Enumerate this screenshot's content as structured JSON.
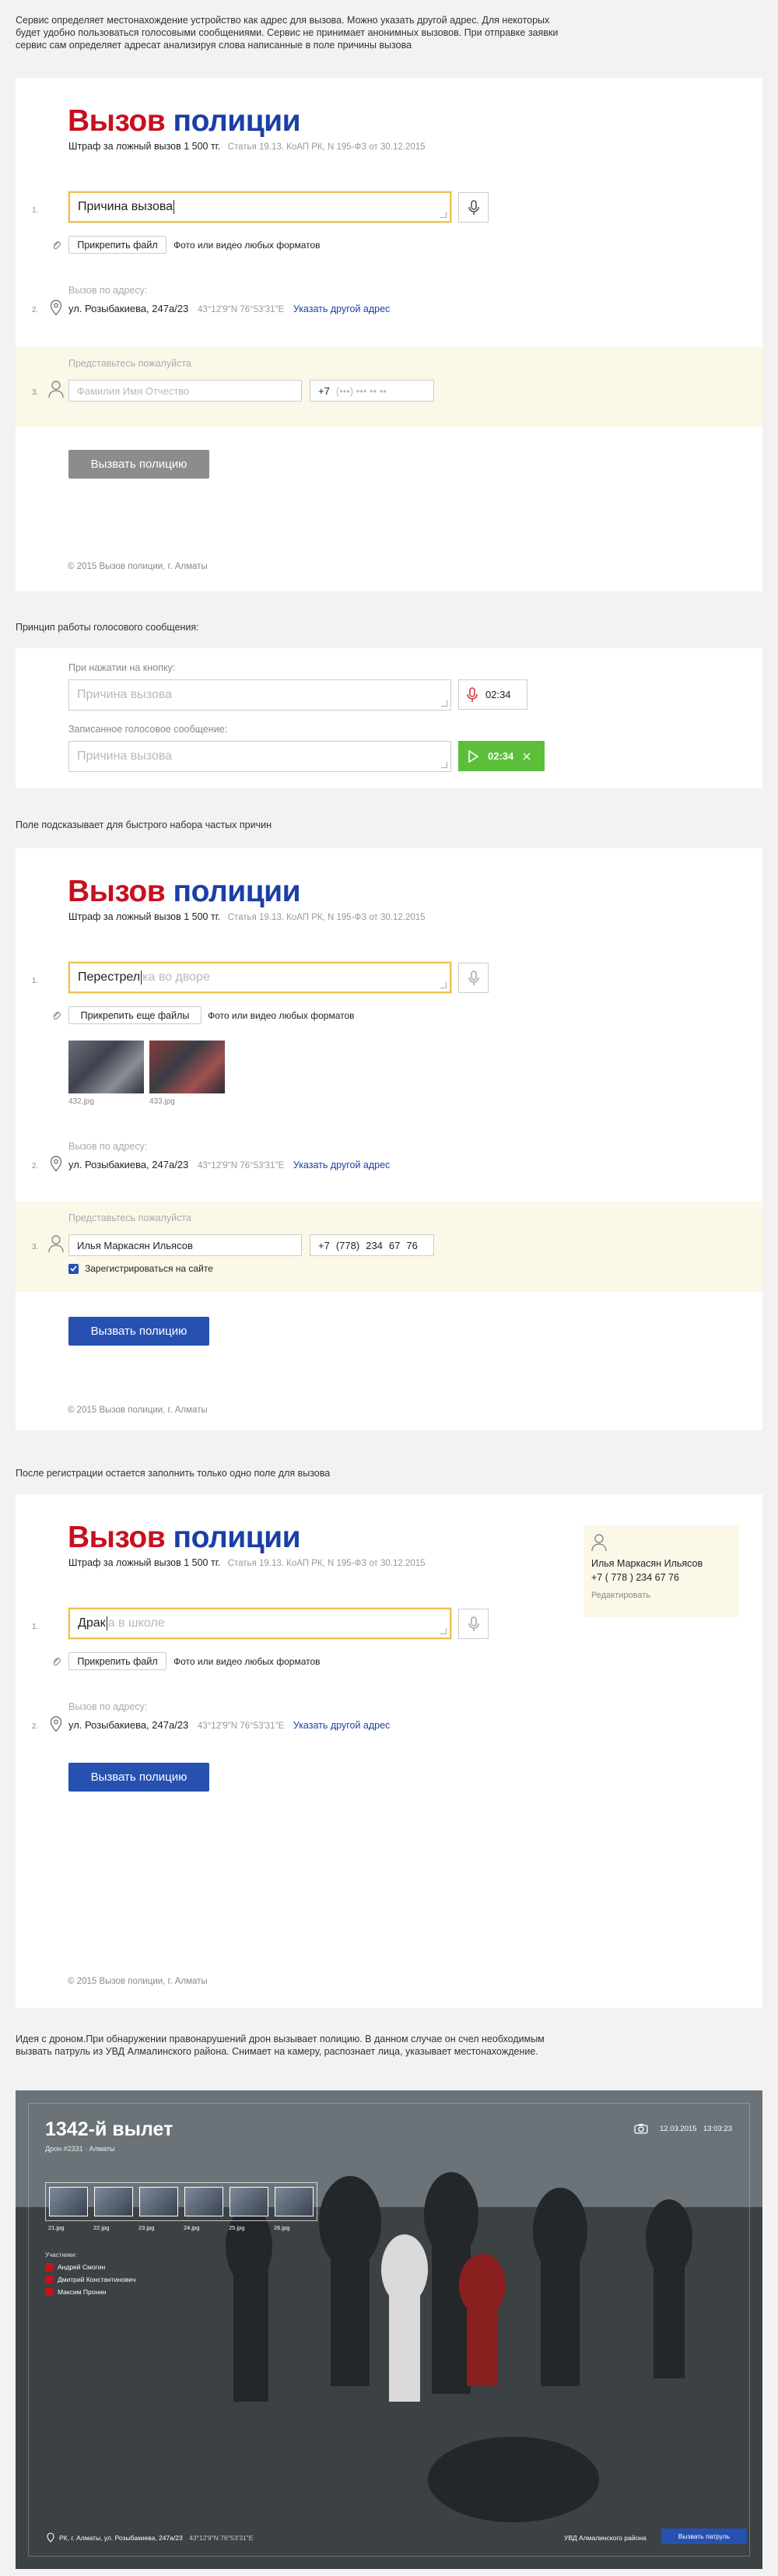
{
  "intro_note": "Сервис определяет местонахождение устройство как адрес для вызова. Можно указать другой адрес. Для некоторых будет удобно пользоваться голосовыми сообщениями. Сервис не принимает анонимных вызовов. При отправке заявки сервис сам определяет адресат анализируя слова написанные в поле причины вызова",
  "brand": {
    "part1": "Вызов",
    "part2": "полиции"
  },
  "colors": {
    "brand_red": "#c8101e",
    "brand_blue": "#1a3fa6",
    "focus_border": "#f0c050",
    "band_bg": "#fbf8e8",
    "primary_button": "#2651b0",
    "disabled_button": "#8c8c8c",
    "green_play": "#5bbf3a",
    "mic_red": "#d83a3a"
  },
  "fine": {
    "text": "Штраф за ложный вызов 1 500 тг.",
    "law": "Статья 19.13. КоАП РК, N 195-ФЗ от 30.12.2015"
  },
  "form1": {
    "num1": "1.",
    "reason_value": "Причина вызова",
    "attach_button": "Прикрепить файл",
    "attach_hint": "Фото или видео любых форматов",
    "address_label": "Вызов по адресу:",
    "num2": "2.",
    "address": "ул. Розыбакиева, 247а/23",
    "coords": "43°12'9\"N  76°53'31\"E",
    "other_address": "Указать другой адрес",
    "introduce_label": "Представьтесь пожалуйста",
    "num3": "3.",
    "name_placeholder": "Фамилия Имя Отчество",
    "phone_prefix": "+7",
    "phone_placeholder": "(•••)  •••  ••  ••",
    "submit": "Вызвать полицию",
    "footer": "© 2015 Вызов полиции, г. Алматы"
  },
  "voice_note": "Принцип работы голосового сообщения:",
  "voice": {
    "label1": "При нажатии на кнопку:",
    "placeholder": "Причина вызова",
    "timer1": "02:34",
    "label2": "Записанное голосовое сообщение:",
    "timer2": "02:34"
  },
  "suggest_note": "Поле подсказывает для быстрого набора частых причин",
  "form2": {
    "reason_typed": "Перестрел",
    "reason_suggest": "ка во дворе",
    "attach_button": "Прикрепить еще файлы",
    "attach_hint": "Фото или видео любых форматов",
    "files": [
      "432.jpg",
      "433.jpg"
    ],
    "name_value": "Илья Маркасян Ильясов",
    "phone_prefix": "+7",
    "phone_code": "778",
    "phone_part1": "234",
    "phone_part2": "67",
    "phone_part3": "76",
    "register_label": "Зарегистрироваться на сайте",
    "register_checked": true
  },
  "registered_note": "После регистрации остается заполнить только одно поле для вызова",
  "form3": {
    "reason_typed": "Драк",
    "reason_suggest": "а в школе",
    "profile_name": "Илья Маркасян Ильясов",
    "profile_phone": "+7 ( 778 )  234  67  76",
    "profile_edit": "Редактировать"
  },
  "drone_note": "Идея с дроном.При обнаружении правонарушений дрон вызывает полицию. В данном случае он счел необходимым вызвать патруль из УВД Алмалинского района. Снимает на камеру, распознает лица, указывает местонахождение.",
  "drone": {
    "title": "1342-й вылет",
    "subtitle": "Дрон #2331  ·  Алматы",
    "date": "12.03.2015",
    "time": "13:03:23",
    "suspects_label": "Участники:",
    "suspects": [
      "Андрей Смогин",
      "Дмитрий Константинович",
      "Максим Пронин"
    ],
    "thumb_caps": [
      "21.jpg",
      "22.jpg",
      "23.jpg",
      "24.jpg",
      "25.jpg",
      "26.jpg"
    ],
    "location": "РК, г. Алматы, ул. Розыбакиева, 247а/23",
    "coords": "43°12'9\"N  76°53'31\"E",
    "district": "УВД Алмалинского района",
    "call_button": "Вызвать патруль"
  }
}
